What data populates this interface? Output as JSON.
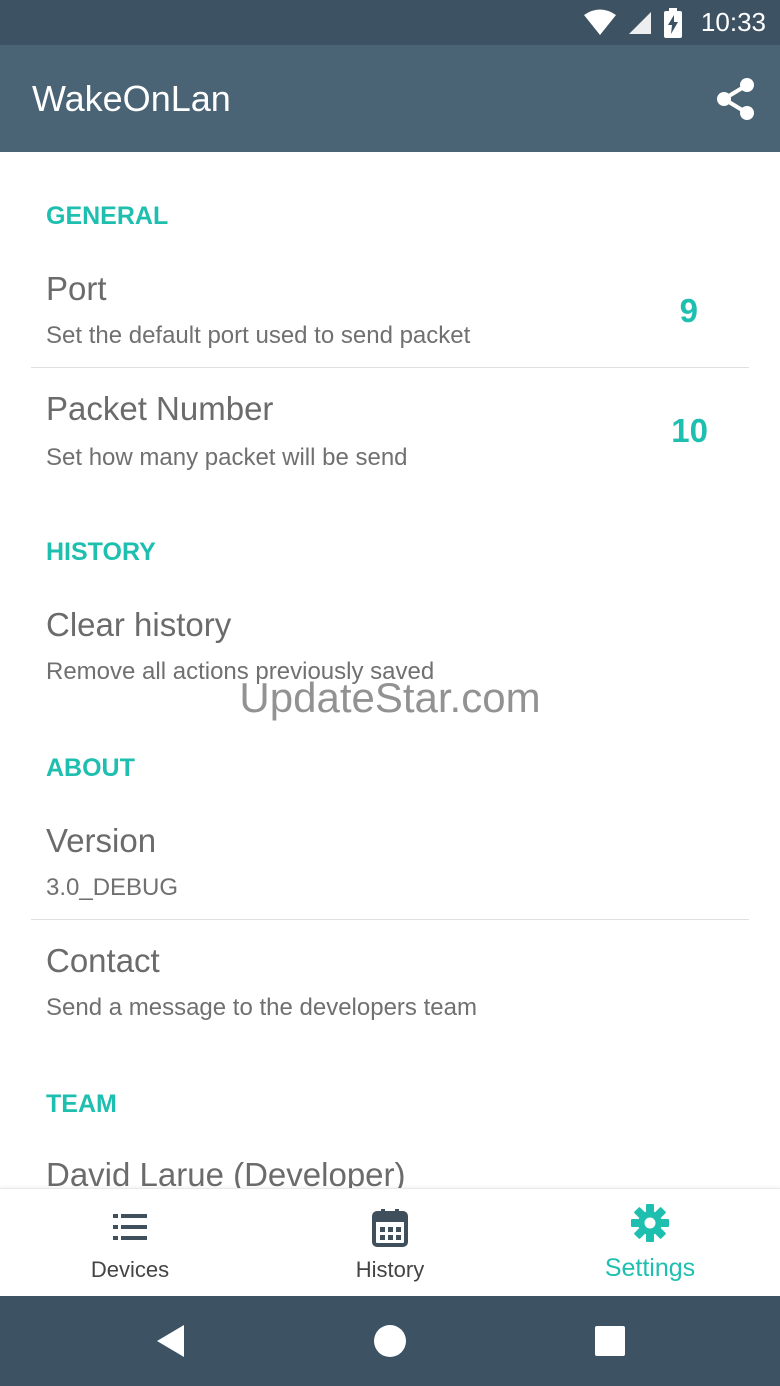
{
  "status_bar": {
    "time": "10:33",
    "icons": [
      "wifi-icon",
      "signal-icon",
      "battery-charging-icon"
    ]
  },
  "app_bar": {
    "title": "WakeOnLan",
    "share_icon": "share-icon"
  },
  "sections": {
    "general": {
      "header": "GENERAL",
      "port": {
        "title": "Port",
        "summary": "Set the default port used to send packet",
        "value": "9"
      },
      "packet_number": {
        "title": "Packet Number",
        "summary": "Set how many packet will be send",
        "value": "10"
      }
    },
    "history": {
      "header": "HISTORY",
      "clear": {
        "title": "Clear history",
        "summary": "Remove all actions previously saved"
      }
    },
    "about": {
      "header": "ABOUT",
      "version": {
        "title": "Version",
        "summary": "3.0_DEBUG"
      },
      "contact": {
        "title": "Contact",
        "summary": "Send a message to the developers team"
      }
    },
    "team": {
      "header": "TEAM",
      "member1": {
        "title": "David Larue (Developer)"
      }
    }
  },
  "watermark": "UpdateStar.com",
  "bottom_nav": {
    "items": [
      {
        "label": "Devices",
        "icon": "list-icon",
        "active": false
      },
      {
        "label": "History",
        "icon": "calendar-icon",
        "active": false
      },
      {
        "label": "Settings",
        "icon": "gear-icon",
        "active": true
      }
    ]
  },
  "system_nav": {
    "back": "back-icon",
    "home": "home-icon",
    "recents": "recents-icon"
  },
  "colors": {
    "accent": "#1fbfb0",
    "app_bar": "#4a6375",
    "status_bar": "#3d5262"
  }
}
